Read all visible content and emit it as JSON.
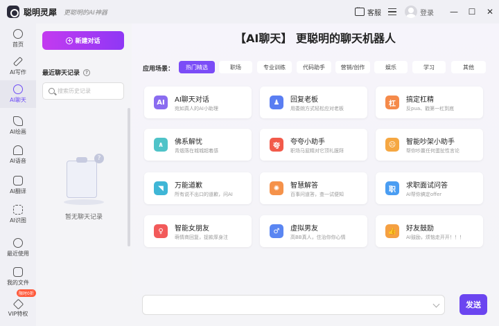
{
  "titlebar": {
    "app_name": "聪明灵犀",
    "slogan": "更聪明的AI神器",
    "service_label": "客服",
    "login_label": "登录",
    "min_symbol": "—",
    "max_symbol": "☐",
    "close_symbol": "✕"
  },
  "nav": {
    "items": [
      {
        "label": "首页",
        "icon": "home-icon"
      },
      {
        "label": "AI写作",
        "icon": "pen-icon"
      },
      {
        "label": "AI聊天",
        "icon": "chat-icon",
        "active": true
      },
      {
        "label": "AI绘画",
        "icon": "brush-icon"
      },
      {
        "label": "AI语音",
        "icon": "headphone-icon"
      },
      {
        "label": "AI翻译",
        "icon": "translate-icon"
      },
      {
        "label": "AI识图",
        "icon": "scan-icon"
      },
      {
        "label": "最近使用",
        "icon": "clock-icon"
      },
      {
        "label": "我的文件",
        "icon": "file-icon"
      },
      {
        "label": "VIP特权",
        "icon": "diamond-icon"
      }
    ],
    "vip_badge": "限时0折"
  },
  "sidebar": {
    "new_chat": "新建对话",
    "recent_title": "最近聊天记录",
    "search_placeholder": "搜索历史记录",
    "empty_text": "暂无聊天记录"
  },
  "main": {
    "title": "【AI聊天】 更聪明的聊天机器人",
    "scene_label": "应用场景：",
    "tags": [
      "热门精选",
      "职场",
      "专业训练",
      "代码助手",
      "营销/创作",
      "娱乐",
      "学习",
      "其他"
    ],
    "cards": [
      {
        "title": "AI聊天对话",
        "desc": "宛如真人的AI小助理",
        "color": "#8a6cf0",
        "glyph": "AI"
      },
      {
        "title": "回复老板",
        "desc": "用委婉方式轻松应对老板",
        "color": "#5a7ef2",
        "glyph": "♟"
      },
      {
        "title": "搞定杠精",
        "desc": "反pua、戳第一杠到底",
        "color": "#f58a4a",
        "glyph": "杠"
      },
      {
        "title": "佛系解忧",
        "desc": "青烟落在城城超着感",
        "color": "#4fc3c8",
        "glyph": "∧"
      },
      {
        "title": "夸夸小助手",
        "desc": "职场马屁精对它顶礼膜拜",
        "color": "#f25a4a",
        "glyph": "夸"
      },
      {
        "title": "智能吵架小助手",
        "desc": "帮你吵赢任何蛋扯性言论",
        "color": "#f5a742",
        "glyph": "☹"
      },
      {
        "title": "万能道歉",
        "desc": "所有说不出口的道歉，问AI",
        "color": "#3fb6d6",
        "glyph": "◥"
      },
      {
        "title": "智慧解答",
        "desc": "百事问道答，查一试便知",
        "color": "#f5924a",
        "glyph": "✺"
      },
      {
        "title": "求职面试问答",
        "desc": "AI帮你搞定offer",
        "color": "#4a9df2",
        "glyph": "职"
      },
      {
        "title": "智能女朋友",
        "desc": "萌情商回复，捉款厚身注",
        "color": "#f25a5a",
        "glyph": "♀"
      },
      {
        "title": "虚拟男友",
        "desc": "高BB真人，住治你你心情",
        "color": "#5a86f2",
        "glyph": "♂"
      },
      {
        "title": "好友鼓励",
        "desc": "AI鼓励，烦恼走开开！！！",
        "color": "#f5a042",
        "glyph": "👍"
      }
    ]
  },
  "input": {
    "placeholder": "",
    "send_label": "发送"
  }
}
